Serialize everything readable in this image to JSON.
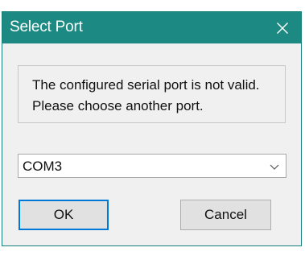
{
  "window": {
    "title": "Select Port",
    "close_icon": "close-icon",
    "titlebar_color": "#1c8a82"
  },
  "message": {
    "line1": "The configured serial port is not valid.",
    "line2": "Please choose another port."
  },
  "port_select": {
    "selected": "COM3",
    "arrow_icon": "chevron-down-icon"
  },
  "buttons": {
    "ok_label": "OK",
    "cancel_label": "Cancel",
    "default_border_color": "#0078d7"
  }
}
